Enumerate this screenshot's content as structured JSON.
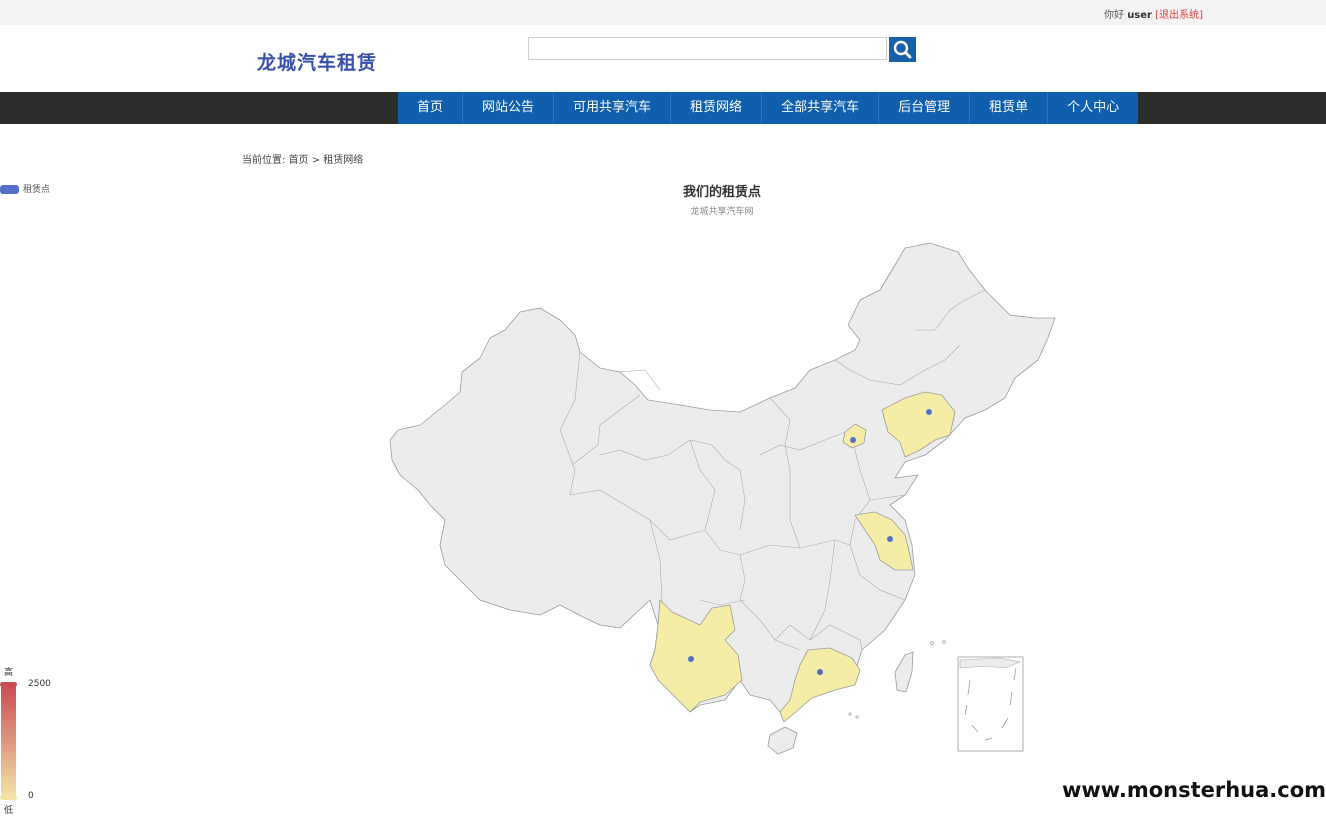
{
  "topbar": {
    "greeting": "你好",
    "username": "user",
    "logout": "[退出系统]"
  },
  "header": {
    "logo": "龙城汽车租赁",
    "search": {
      "value": "",
      "placeholder": ""
    }
  },
  "nav": [
    "首页",
    "网站公告",
    "可用共享汽车",
    "租赁网络",
    "全部共享汽车",
    "后台管理",
    "租赁单",
    "个人中心"
  ],
  "breadcrumb": "当前位置: 首页 > 租赁网络",
  "chart_data": {
    "type": "map",
    "title": "我们的租赁点",
    "subtitle": "龙城共享汽车网",
    "legend": [
      "租赁点"
    ],
    "visual_map": {
      "min": 0,
      "max": 2500,
      "min_text": "低",
      "max_text": "高",
      "color_low": "#f5e2a5",
      "color_high": "#c94b52"
    },
    "highlighted_regions": [
      "北京",
      "辽宁",
      "江苏",
      "广东",
      "云南"
    ],
    "highlight_color": "#f5eda6",
    "region_color": "#ececec",
    "point_color": "#5470c6"
  },
  "watermark": "www.monsterhua.com"
}
